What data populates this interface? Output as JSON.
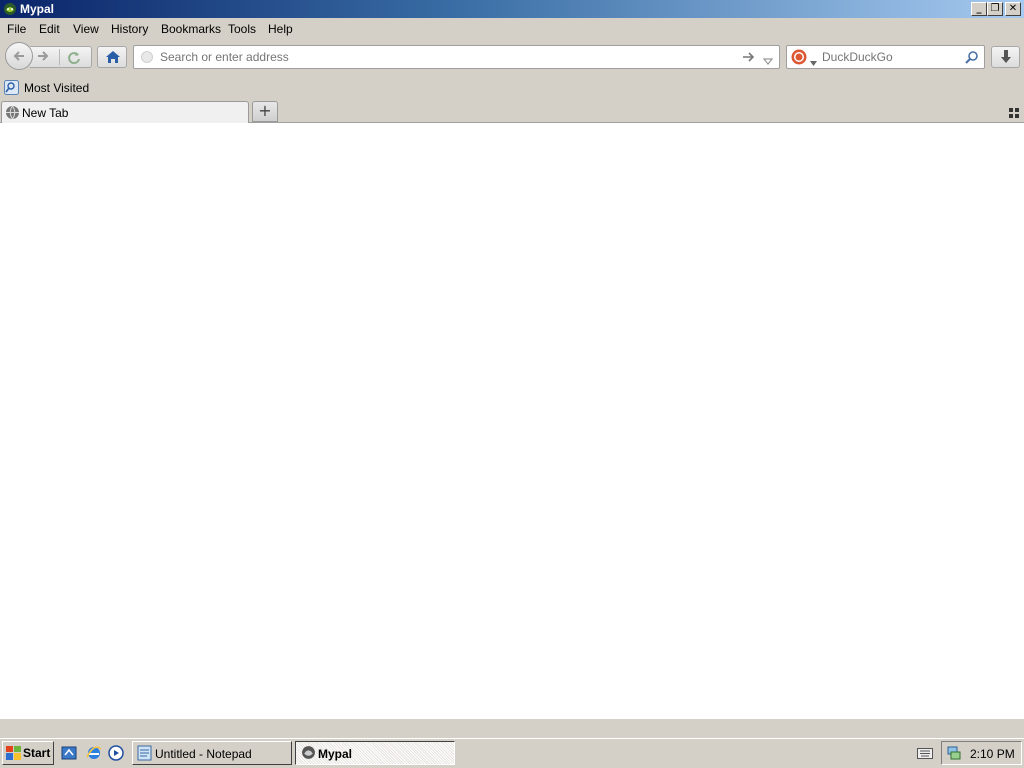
{
  "window": {
    "title": "Mypal"
  },
  "menubar": {
    "items": [
      {
        "label": "File"
      },
      {
        "label": "Edit"
      },
      {
        "label": "View"
      },
      {
        "label": "History"
      },
      {
        "label": "Bookmarks"
      },
      {
        "label": "Tools"
      },
      {
        "label": "Help"
      }
    ]
  },
  "navbar": {
    "url_placeholder": "Search or enter address",
    "url_value": "",
    "search_engine": "DuckDuckGo",
    "search_placeholder": "DuckDuckGo"
  },
  "bookmarks": {
    "items": [
      {
        "label": "Most Visited"
      }
    ]
  },
  "tabs": [
    {
      "label": "New Tab",
      "active": true
    }
  ],
  "taskbar": {
    "start_label": "Start",
    "tasks": [
      {
        "label": "Untitled - Notepad",
        "active": false
      },
      {
        "label": "Mypal",
        "active": true
      }
    ],
    "clock": "2:10 PM"
  },
  "colors": {
    "titlebar_start": "#0a246a",
    "titlebar_end": "#a6caf0",
    "chrome": "#d4d0c8"
  }
}
